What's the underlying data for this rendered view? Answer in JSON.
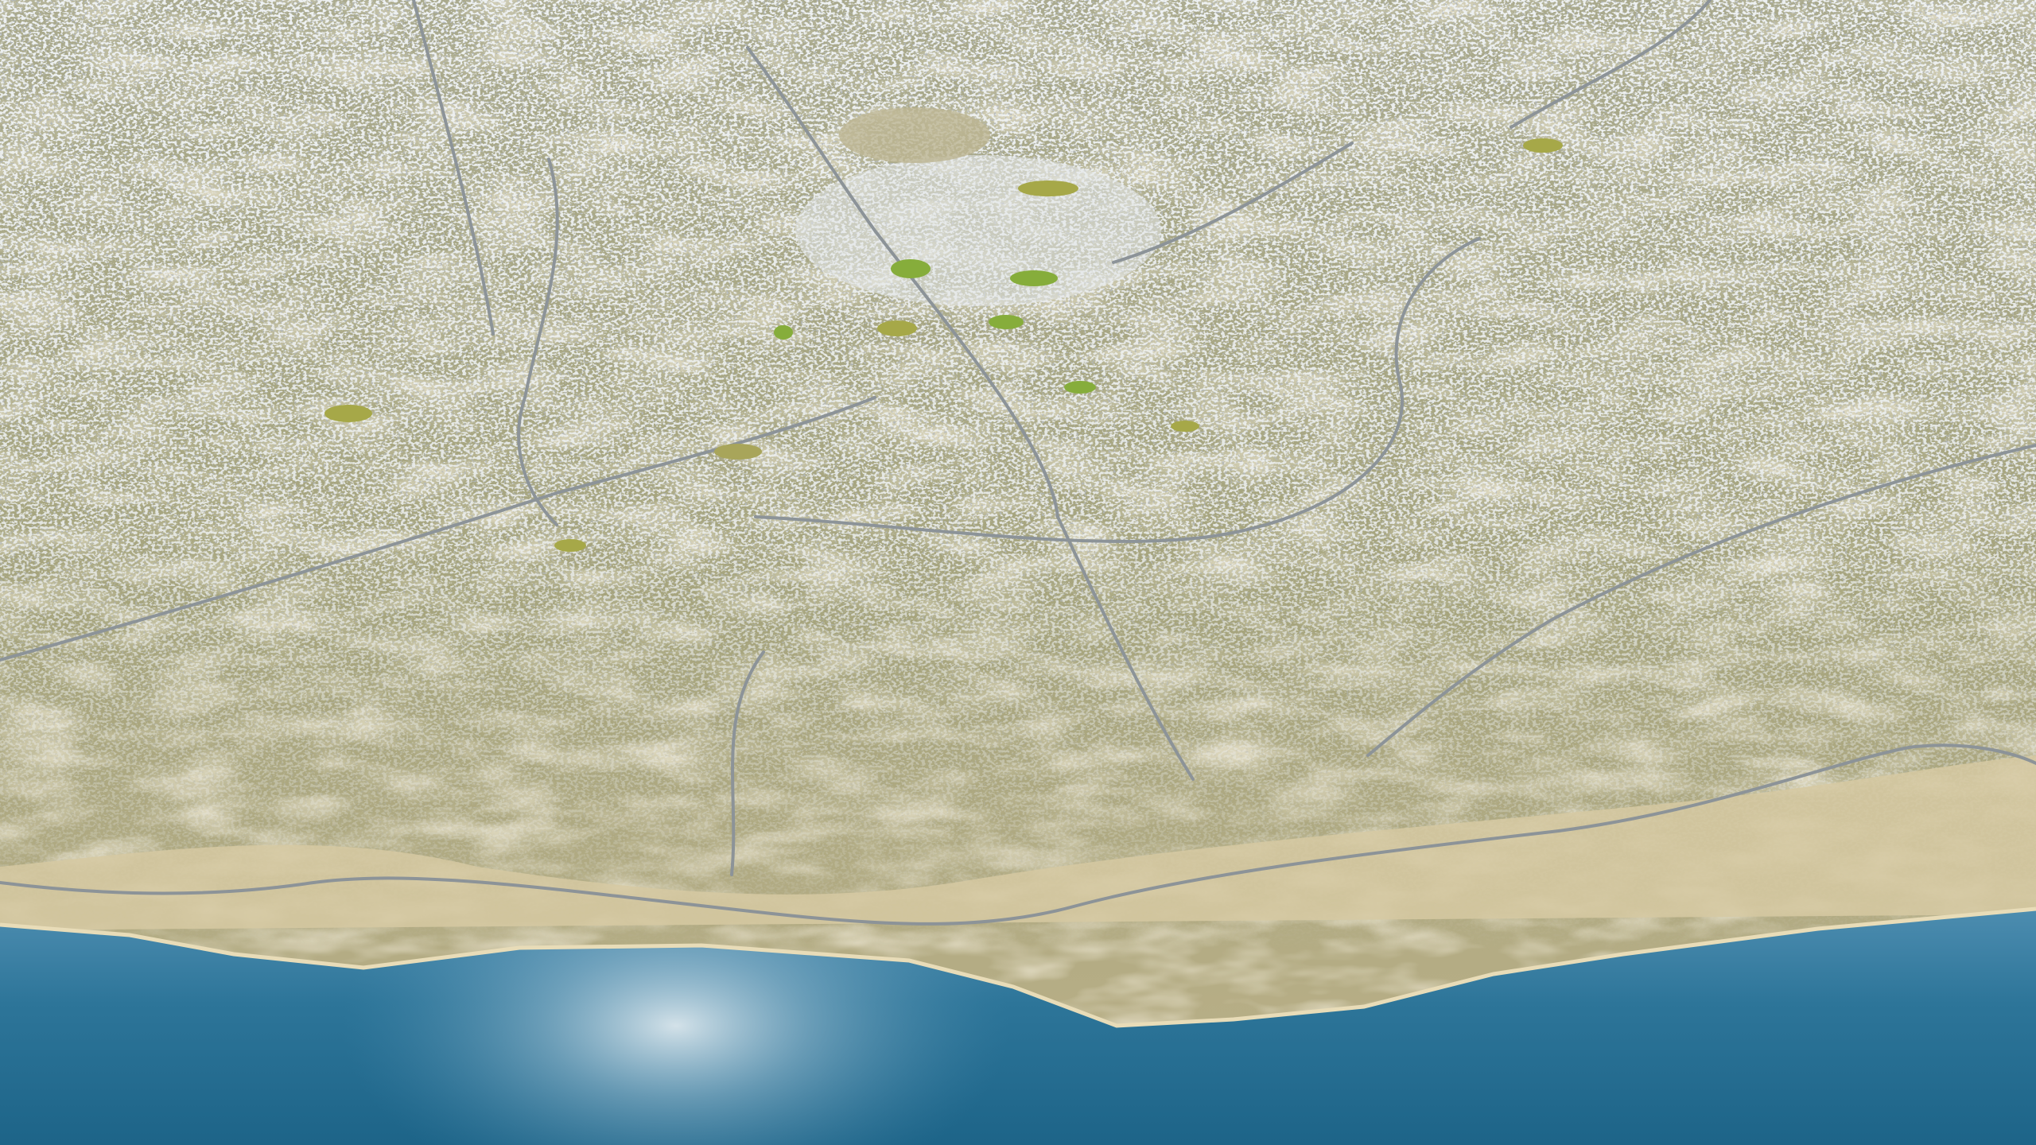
{
  "scene": {
    "type": "3d-aerial-city-render",
    "colors": {
      "sea_deep": "#1f6a8e",
      "sea_light": "#4f8fb0",
      "glare": "#dfe9ef",
      "sand": "#d9cba4",
      "land": "#a9a77f",
      "buildings": "#d8dcde",
      "roads": "#8e959a",
      "parks": "#7fa83a"
    }
  }
}
